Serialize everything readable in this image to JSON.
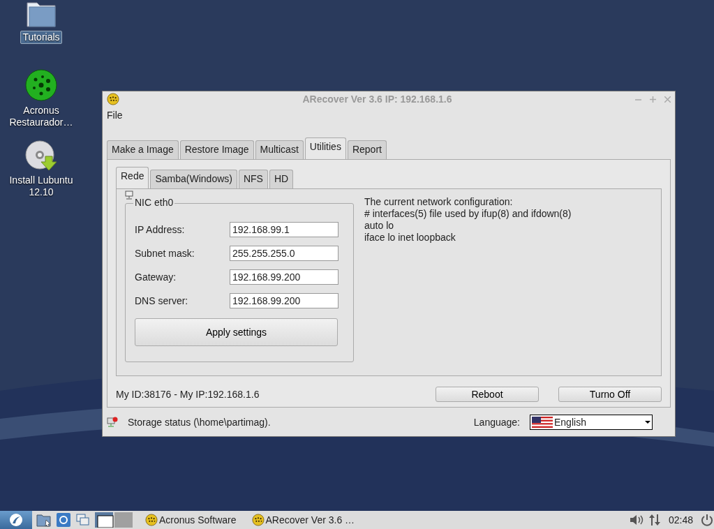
{
  "desktop_icons": [
    {
      "kind": "folder",
      "label": "Tutorials",
      "selected": true
    },
    {
      "kind": "sphere",
      "label": "Acronus Restaurador…",
      "selected": false
    },
    {
      "kind": "disc",
      "label": "Install Lubuntu 12.10",
      "selected": false
    }
  ],
  "window": {
    "title": "ARecover Ver 3.6 IP: 192.168.1.6",
    "menu": [
      "File"
    ],
    "tabs": [
      {
        "label": "Make a Image",
        "selected": false
      },
      {
        "label": "Restore Image",
        "selected": false
      },
      {
        "label": "Multicast",
        "selected": false
      },
      {
        "label": "Utilities",
        "selected": true
      },
      {
        "label": "Report",
        "selected": false
      }
    ],
    "subtabs": [
      {
        "label": "Rede",
        "selected": true
      },
      {
        "label": "Samba(Windows)",
        "selected": false
      },
      {
        "label": "NFS",
        "selected": false
      },
      {
        "label": "HD",
        "selected": false
      }
    ],
    "group_title": "NIC eth0",
    "fields": [
      {
        "label": "IP Address:",
        "value": "192.168.99.1"
      },
      {
        "label": "Subnet mask:",
        "value": "255.255.255.0"
      },
      {
        "label": "Gateway:",
        "value": "192.168.99.200"
      },
      {
        "label": "DNS server:",
        "value": "192.168.99.200"
      }
    ],
    "apply_button": "Apply settings",
    "config_lines": [
      "The current network configuration:",
      "# interfaces(5) file used by ifup(8) and ifdown(8)",
      "auto lo",
      "iface lo inet loopback"
    ],
    "id_text": "My ID:38176 - My IP:192.168.1.6",
    "buttons": [
      "Reboot",
      "Turno Off"
    ],
    "status": "Storage status (\\home\\partimag).",
    "language_label": "Language:",
    "language": "English"
  },
  "taskbar": {
    "tasks": [
      {
        "label": "Acronus Software",
        "selected": false
      },
      {
        "label": "ARecover Ver 3.6 …",
        "selected": false
      }
    ],
    "clock": "02:48"
  }
}
